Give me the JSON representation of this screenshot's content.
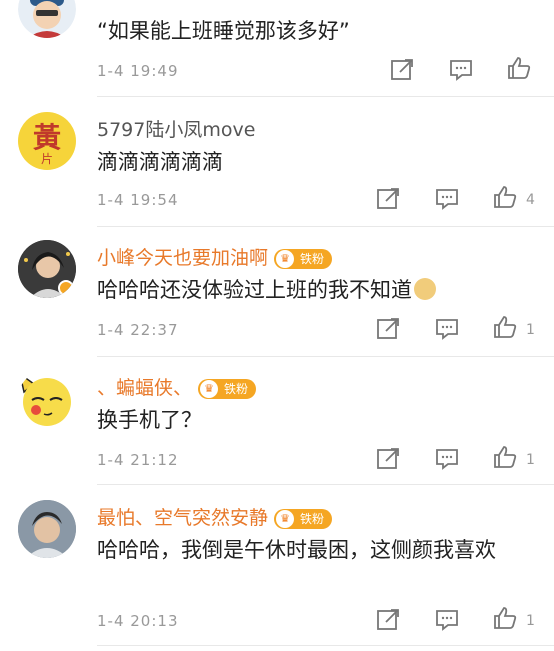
{
  "comments": [
    {
      "username": "",
      "text": "“如果能上班睡觉那该多好”",
      "time": "1-4  19:49",
      "likes": ""
    },
    {
      "username": "5797陆小凤move",
      "avatar_char": "黃",
      "avatar_sub": "片",
      "text": "滴滴滴滴滴滴",
      "time": "1-4  19:54",
      "likes": "4"
    },
    {
      "username": "小峰今天也要加油啊",
      "badge": "铁粉",
      "text": "哈哈哈还没体验过上班的我不知道",
      "time": "1-4  22:37",
      "likes": "1"
    },
    {
      "username": "、蝙蝠侠、",
      "badge": "铁粉",
      "text": "换手机了？",
      "time": "1-4  21:12",
      "likes": "1"
    },
    {
      "username": "最怕、空气突然安静",
      "badge": "铁粉",
      "text": "哈哈哈，我倒是午休时最困，这侧颜我喜欢",
      "time": "1-4  20:13",
      "likes": "1"
    }
  ],
  "colors": {
    "username_orange": "#e8792a",
    "badge_bg": "#f5a623",
    "meta_gray": "#999999"
  },
  "icons": [
    "share-icon",
    "comment-icon",
    "like-icon"
  ]
}
